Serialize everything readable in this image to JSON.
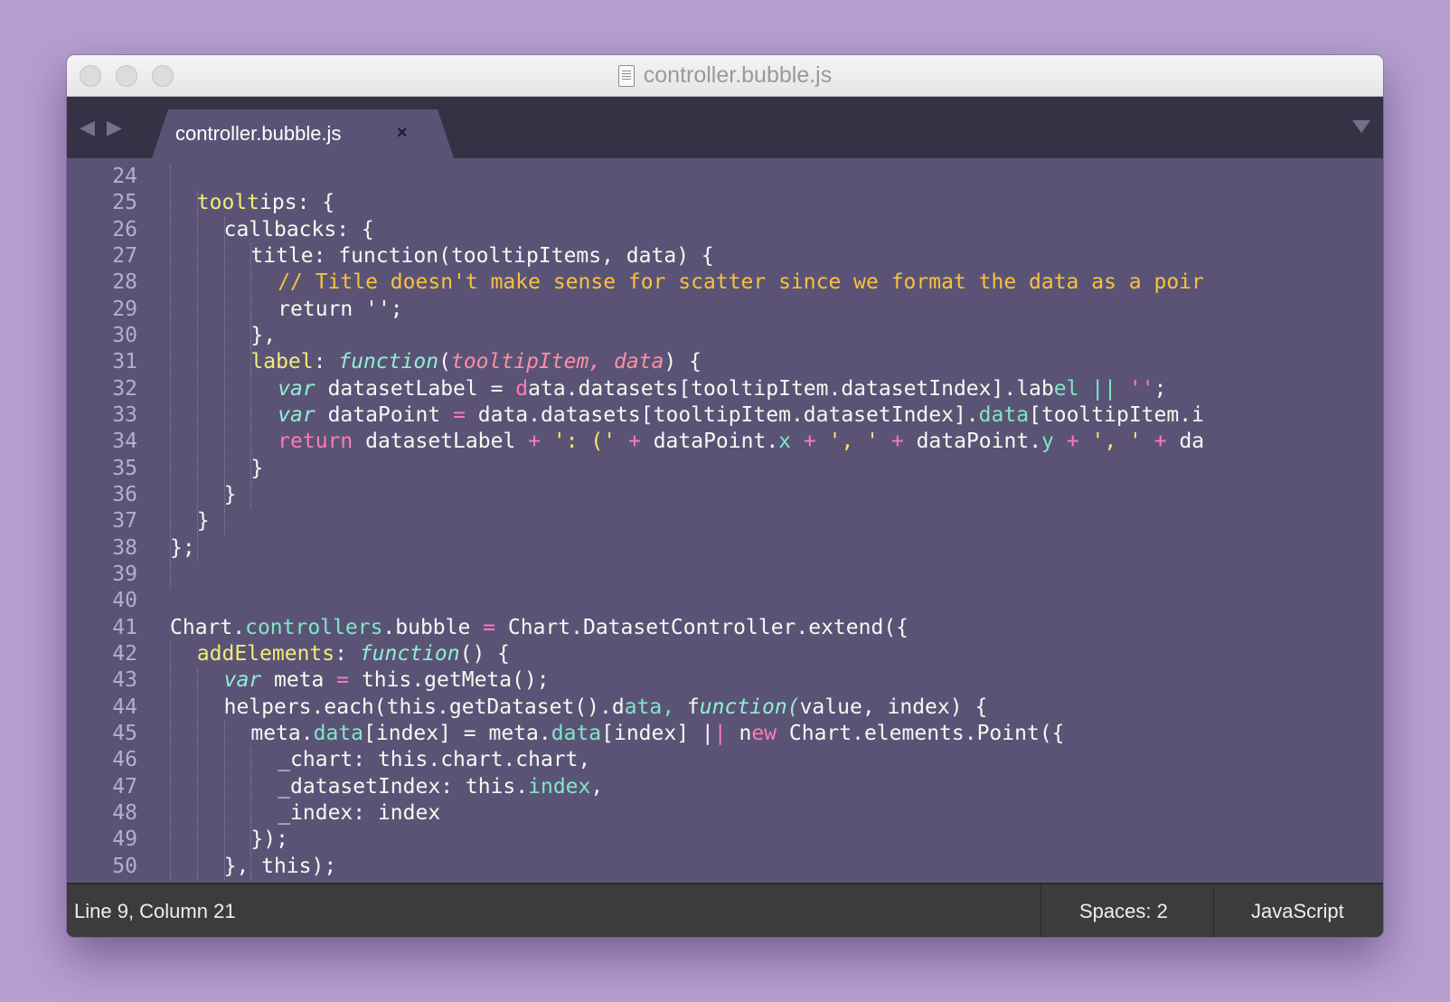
{
  "window": {
    "title": "controller.bubble.js",
    "tab_label": "controller.bubble.js",
    "tab_close_glyph": "×"
  },
  "nav": {
    "back_glyph": "◀",
    "forward_glyph": "▶"
  },
  "editor": {
    "language": "JavaScript",
    "lines": [
      {
        "n": "24",
        "text": ""
      },
      {
        "n": "25",
        "text": "tooltips: {"
      },
      {
        "n": "26",
        "text": "callbacks: {"
      },
      {
        "n": "27",
        "text": "title: function(tooltipItems, data) {"
      },
      {
        "n": "28",
        "text": "// Title doesn't make sense for scatter since we format the data as a poir"
      },
      {
        "n": "29",
        "text": "return '';"
      },
      {
        "n": "30",
        "text": "},"
      },
      {
        "n": "31",
        "text": "label: function(tooltipItem, data) {"
      },
      {
        "n": "32",
        "text": "var datasetLabel = data.datasets[tooltipItem.datasetIndex].label || '';"
      },
      {
        "n": "33",
        "text": "var dataPoint = data.datasets[tooltipItem.datasetIndex].data[tooltipItem.i"
      },
      {
        "n": "34",
        "text": "return datasetLabel + ': (' + dataPoint.x + ', ' + dataPoint.y + ', ' + da"
      },
      {
        "n": "35",
        "text": "}"
      },
      {
        "n": "36",
        "text": "}"
      },
      {
        "n": "37",
        "text": "}"
      },
      {
        "n": "38",
        "text": "};"
      },
      {
        "n": "39",
        "text": ""
      },
      {
        "n": "40",
        "text": ""
      },
      {
        "n": "41",
        "text": "Chart.controllers.bubble = Chart.DatasetController.extend({"
      },
      {
        "n": "42",
        "text": "addElements: function() {"
      },
      {
        "n": "43",
        "text": "var meta = this.getMeta();"
      },
      {
        "n": "44",
        "text": "helpers.each(this.getDataset().data, function(value, index) {"
      },
      {
        "n": "45",
        "text": "meta.data[index] = meta.data[index] || new Chart.elements.Point({"
      },
      {
        "n": "46",
        "text": "_chart: this.chart.chart,"
      },
      {
        "n": "47",
        "text": "_datasetIndex: this.index,"
      },
      {
        "n": "48",
        "text": "_index: index"
      },
      {
        "n": "49",
        "text": "});"
      },
      {
        "n": "50",
        "text": "}, this);"
      }
    ]
  },
  "status": {
    "position": "Line 9, Column 21",
    "indent": "Spaces: 2",
    "syntax": "JavaScript"
  }
}
